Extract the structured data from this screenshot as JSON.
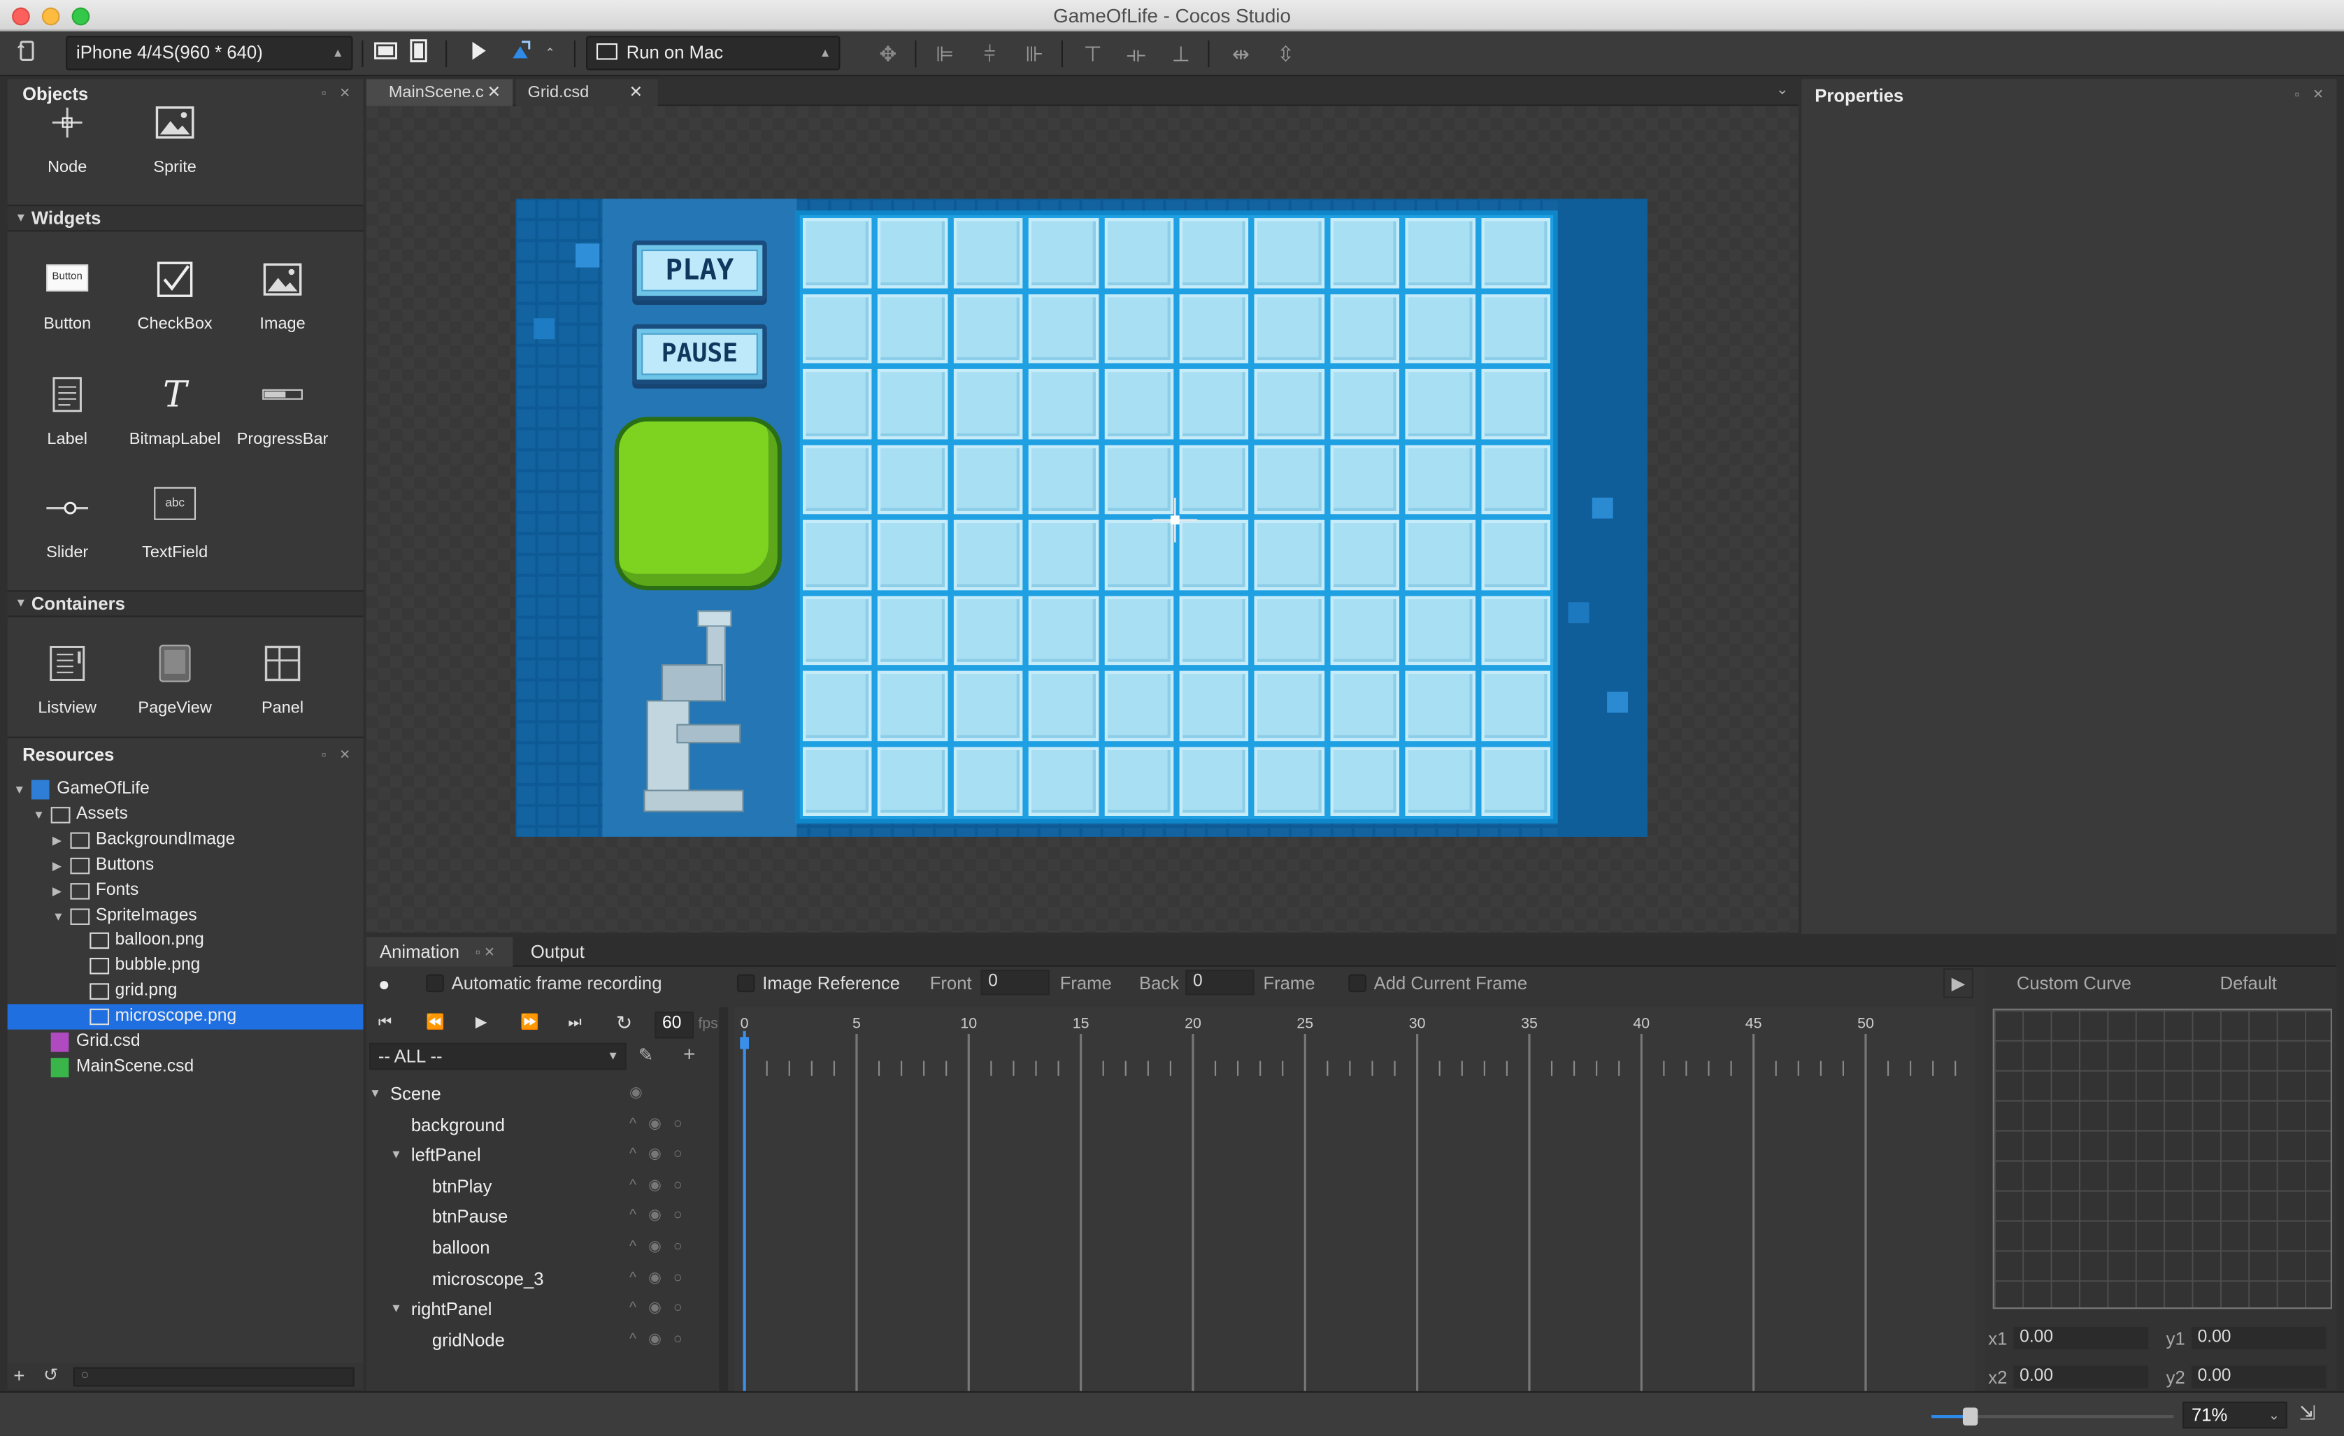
{
  "window": {
    "title": "GameOfLife - Cocos Studio"
  },
  "toolbar": {
    "device": "iPhone 4/4S(960 * 640)",
    "run_target": "Run on Mac"
  },
  "objects_panel": {
    "title": "Objects",
    "items": [
      {
        "label": "Node",
        "icon": "node-icon"
      },
      {
        "label": "Sprite",
        "icon": "sprite-icon"
      }
    ]
  },
  "widgets_panel": {
    "title": "Widgets",
    "items": [
      {
        "label": "Button",
        "icon": "button-icon",
        "icon_text": "Button"
      },
      {
        "label": "CheckBox",
        "icon": "checkbox-icon"
      },
      {
        "label": "Image",
        "icon": "image-icon"
      },
      {
        "label": "Label",
        "icon": "label-icon"
      },
      {
        "label": "BitmapLabel",
        "icon": "bitmap-label-icon",
        "icon_text": "T"
      },
      {
        "label": "ProgressBar",
        "icon": "progressbar-icon"
      },
      {
        "label": "Slider",
        "icon": "slider-icon"
      },
      {
        "label": "TextField",
        "icon": "textfield-icon",
        "icon_text": "abc"
      }
    ]
  },
  "containers_panel": {
    "title": "Containers",
    "items": [
      {
        "label": "Listview",
        "icon": "listview-icon"
      },
      {
        "label": "PageView",
        "icon": "pageview-icon"
      },
      {
        "label": "Panel",
        "icon": "panel-icon"
      }
    ]
  },
  "resources_panel": {
    "title": "Resources",
    "tree": [
      {
        "label": "GameOfLife",
        "type": "project",
        "level": 0,
        "expanded": true
      },
      {
        "label": "Assets",
        "type": "folder",
        "level": 1,
        "expanded": true
      },
      {
        "label": "BackgroundImage",
        "type": "folder",
        "level": 2,
        "expanded": false
      },
      {
        "label": "Buttons",
        "type": "folder",
        "level": 2,
        "expanded": false
      },
      {
        "label": "Fonts",
        "type": "folder",
        "level": 2,
        "expanded": false
      },
      {
        "label": "SpriteImages",
        "type": "folder",
        "level": 2,
        "expanded": true
      },
      {
        "label": "balloon.png",
        "type": "image",
        "level": 3
      },
      {
        "label": "bubble.png",
        "type": "image",
        "level": 3
      },
      {
        "label": "grid.png",
        "type": "image",
        "level": 3
      },
      {
        "label": "microscope.png",
        "type": "image",
        "level": 3,
        "selected": true
      },
      {
        "label": "Grid.csd",
        "type": "csd-purple",
        "level": 1
      },
      {
        "label": "MainScene.csd",
        "type": "csd-green",
        "level": 1
      }
    ]
  },
  "editor_tabs": [
    {
      "label": "MainScene.c",
      "active": true
    },
    {
      "label": "Grid.csd",
      "active": false
    }
  ],
  "scene": {
    "play_label": "PLAY",
    "pause_label": "PAUSE",
    "grid_cols": 10,
    "grid_rows": 8
  },
  "properties_panel": {
    "title": "Properties"
  },
  "animation_panel": {
    "tabs": [
      "Animation",
      "Output"
    ],
    "auto_record": "Automatic frame recording",
    "image_reference": "Image Reference",
    "front_label": "Front",
    "front_value": "0",
    "frame_label": "Frame",
    "back_label": "Back",
    "back_value": "0",
    "add_frame": "Add Current Frame",
    "fps_value": "60",
    "fps_unit": "fps",
    "filter": "-- ALL --",
    "ticks": [
      "0",
      "5",
      "10",
      "15",
      "20",
      "25",
      "30",
      "35",
      "40",
      "45",
      "50",
      "5"
    ],
    "nodes": [
      {
        "label": "Scene",
        "level": 0,
        "expanded": true
      },
      {
        "label": "background",
        "level": 1
      },
      {
        "label": "leftPanel",
        "level": 1,
        "expanded": true
      },
      {
        "label": "btnPlay",
        "level": 2
      },
      {
        "label": "btnPause",
        "level": 2
      },
      {
        "label": "balloon",
        "level": 2
      },
      {
        "label": "microscope_3",
        "level": 2
      },
      {
        "label": "rightPanel",
        "level": 1,
        "expanded": true
      },
      {
        "label": "gridNode",
        "level": 2
      }
    ],
    "curve_label": "Custom Curve",
    "curve_value": "Default",
    "x1": "0.00",
    "y1": "0.00",
    "x2": "0.00",
    "y2": "0.00",
    "x1_label": "x1",
    "y1_label": "y1",
    "x2_label": "x2",
    "y2_label": "y2"
  },
  "status": {
    "zoom": "71%",
    "zoom_fraction": 0.71
  }
}
